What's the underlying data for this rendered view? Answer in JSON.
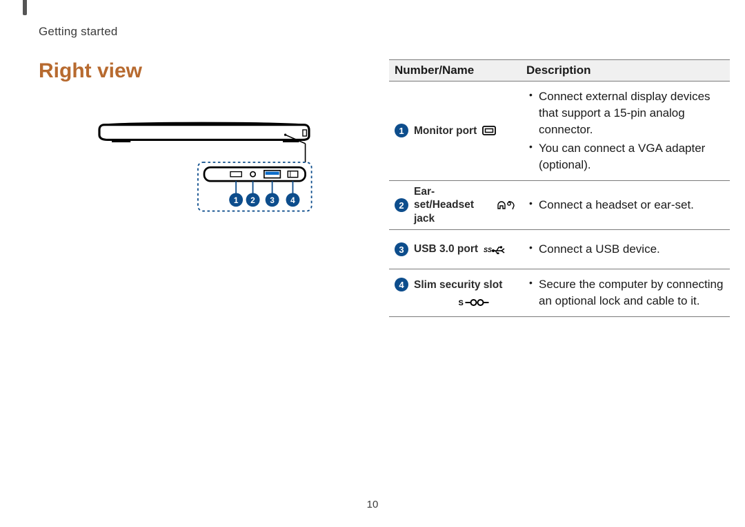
{
  "breadcrumb": "Getting started",
  "title": "Right view",
  "page_number": "10",
  "table": {
    "headers": [
      "Number/Name",
      "Description"
    ],
    "rows": [
      {
        "num": "1",
        "name": "Monitor port",
        "icon": "monitor",
        "desc": [
          "Connect external display devices that support a 15-pin analog connector.",
          "You can connect a VGA adapter (optional)."
        ]
      },
      {
        "num": "2",
        "name": "Ear-set/Headset jack",
        "icon": "headset",
        "desc": [
          "Connect a headset or ear-set."
        ]
      },
      {
        "num": "3",
        "name": "USB 3.0 port",
        "icon": "usb",
        "desc": [
          "Connect a USB device."
        ]
      },
      {
        "num": "4",
        "name": "Slim security slot",
        "icon": "security",
        "desc": [
          "Secure the computer by connecting an optional lock and cable to it."
        ]
      }
    ]
  },
  "diagram": {
    "callouts": [
      "1",
      "2",
      "3",
      "4"
    ]
  }
}
